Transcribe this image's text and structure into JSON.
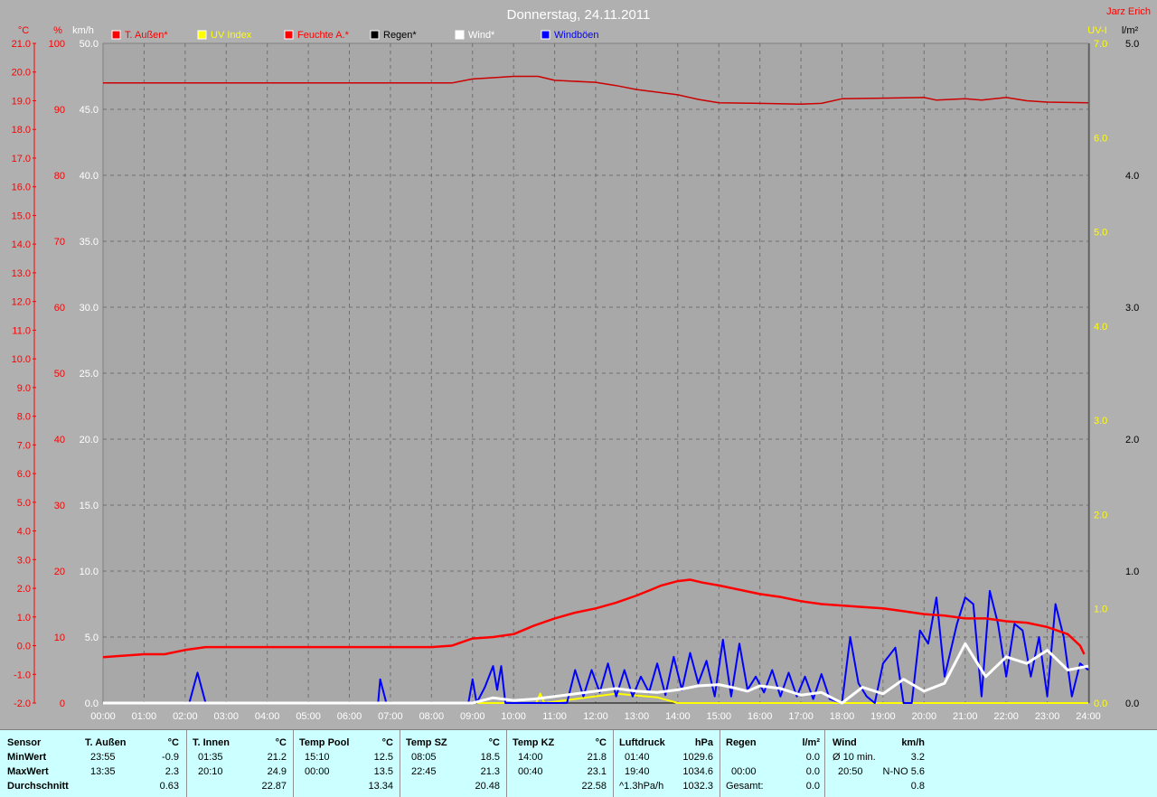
{
  "title": "Donnerstag, 24.11.2011",
  "author": "Jarz Erich",
  "colors": {
    "background": "#b0b0b0",
    "plot_bg": "#a8a8a8",
    "temp": "#ff0000",
    "humidity": "#cc0000",
    "uv": "#ffff00",
    "rain": "#000000",
    "wind": "#ffffff",
    "gust": "#0000ff",
    "panel_bg": "#ccffff"
  },
  "axes": {
    "temp_unit": "°C",
    "hum_unit": "%",
    "wind_unit": "km/h",
    "uv_unit": "UV-I",
    "rain_unit": "l/m²",
    "temp_ticks": [
      "21.0",
      "20.0",
      "19.0",
      "18.0",
      "17.0",
      "16.0",
      "15.0",
      "14.0",
      "13.0",
      "12.0",
      "11.0",
      "10.0",
      "9.0",
      "8.0",
      "7.0",
      "6.0",
      "5.0",
      "4.0",
      "3.0",
      "2.0",
      "1.0",
      "0.0",
      "-1.0",
      "-2.0"
    ],
    "hum_ticks": [
      "100",
      "90",
      "80",
      "70",
      "60",
      "50",
      "40",
      "30",
      "20",
      "10",
      "0"
    ],
    "wind_ticks": [
      "50.0",
      "45.0",
      "40.0",
      "35.0",
      "30.0",
      "25.0",
      "20.0",
      "15.0",
      "10.0",
      "5.0",
      "0.0"
    ],
    "uv_ticks": [
      "7.0",
      "6.0",
      "5.0",
      "4.0",
      "3.0",
      "2.0",
      "1.0",
      "0.0"
    ],
    "rain_ticks": [
      "5.0",
      "4.0",
      "3.0",
      "2.0",
      "1.0",
      "0.0"
    ],
    "time_ticks": [
      "00:00",
      "01:00",
      "02:00",
      "03:00",
      "04:00",
      "05:00",
      "06:00",
      "07:00",
      "08:00",
      "09:00",
      "10:00",
      "11:00",
      "12:00",
      "13:00",
      "14:00",
      "15:00",
      "16:00",
      "17:00",
      "18:00",
      "19:00",
      "20:00",
      "21:00",
      "22:00",
      "23:00",
      "24:00"
    ]
  },
  "legend": [
    {
      "label": "T. Außen*",
      "color": "#ff0000"
    },
    {
      "label": "UV Index",
      "color": "#ffff00"
    },
    {
      "label": "Feuchte A.*",
      "color": "#ff0000"
    },
    {
      "label": "Regen*",
      "color": "#000000"
    },
    {
      "label": "Wind*",
      "color": "#ffffff"
    },
    {
      "label": "Windböen",
      "color": "#0000ff"
    }
  ],
  "chart_data": {
    "type": "line",
    "title": "Donnerstag, 24.11.2011",
    "x_unit": "hours",
    "xlim": [
      0,
      24
    ],
    "grid": true,
    "legend_position": "top",
    "series": [
      {
        "name": "T. Außen*",
        "axis": "temp",
        "ylim": [
          -2,
          21
        ],
        "points": [
          [
            0,
            -0.4
          ],
          [
            0.5,
            -0.35
          ],
          [
            1,
            -0.3
          ],
          [
            1.5,
            -0.3
          ],
          [
            2,
            -0.15
          ],
          [
            2.5,
            -0.05
          ],
          [
            3,
            -0.05
          ],
          [
            3.5,
            -0.05
          ],
          [
            4,
            -0.05
          ],
          [
            5,
            -0.05
          ],
          [
            6,
            -0.05
          ],
          [
            7,
            -0.05
          ],
          [
            8,
            -0.05
          ],
          [
            8.5,
            0.0
          ],
          [
            9,
            0.25
          ],
          [
            9.5,
            0.3
          ],
          [
            10,
            0.4
          ],
          [
            10.5,
            0.7
          ],
          [
            11,
            0.95
          ],
          [
            11.5,
            1.15
          ],
          [
            12,
            1.3
          ],
          [
            12.5,
            1.5
          ],
          [
            13,
            1.75
          ],
          [
            13.35,
            1.95
          ],
          [
            13.6,
            2.1
          ],
          [
            14,
            2.25
          ],
          [
            14.3,
            2.3
          ],
          [
            14.6,
            2.2
          ],
          [
            15,
            2.1
          ],
          [
            15.5,
            1.95
          ],
          [
            16,
            1.8
          ],
          [
            16.5,
            1.7
          ],
          [
            17,
            1.55
          ],
          [
            17.5,
            1.45
          ],
          [
            18,
            1.4
          ],
          [
            18.5,
            1.35
          ],
          [
            19,
            1.3
          ],
          [
            19.5,
            1.2
          ],
          [
            20,
            1.1
          ],
          [
            20.5,
            1.05
          ],
          [
            21,
            0.95
          ],
          [
            21.5,
            0.95
          ],
          [
            22,
            0.85
          ],
          [
            22.5,
            0.8
          ],
          [
            23,
            0.65
          ],
          [
            23.5,
            0.4
          ],
          [
            23.8,
            0.0
          ],
          [
            23.9,
            -0.3
          ]
        ]
      },
      {
        "name": "Feuchte A.*",
        "axis": "hum",
        "ylim": [
          0,
          100
        ],
        "points": [
          [
            0,
            94
          ],
          [
            8.5,
            94
          ],
          [
            9,
            94.6
          ],
          [
            9.5,
            94.8
          ],
          [
            10,
            95
          ],
          [
            10.6,
            95
          ],
          [
            11,
            94.4
          ],
          [
            12,
            94.1
          ],
          [
            12.5,
            93.6
          ],
          [
            13,
            93
          ],
          [
            14,
            92.2
          ],
          [
            14.5,
            91.5
          ],
          [
            15,
            91
          ],
          [
            16,
            90.9
          ],
          [
            17,
            90.8
          ],
          [
            17.5,
            90.9
          ],
          [
            18,
            91.6
          ],
          [
            19,
            91.7
          ],
          [
            20,
            91.8
          ],
          [
            20.3,
            91.4
          ],
          [
            21,
            91.6
          ],
          [
            21.4,
            91.4
          ],
          [
            22,
            91.8
          ],
          [
            22.5,
            91.3
          ],
          [
            23,
            91.1
          ],
          [
            24,
            91.0
          ]
        ]
      },
      {
        "name": "Wind*",
        "axis": "wind",
        "ylim": [
          0,
          50
        ],
        "points": [
          [
            0,
            0
          ],
          [
            9,
            0
          ],
          [
            9.5,
            0.4
          ],
          [
            10,
            0.2
          ],
          [
            10.5,
            0.3
          ],
          [
            11,
            0.5
          ],
          [
            12,
            0.9
          ],
          [
            12.5,
            1.1
          ],
          [
            13,
            0.9
          ],
          [
            13.5,
            0.8
          ],
          [
            14,
            1.0
          ],
          [
            14.5,
            1.3
          ],
          [
            15,
            1.4
          ],
          [
            15.3,
            1.2
          ],
          [
            15.7,
            0.9
          ],
          [
            16,
            1.3
          ],
          [
            16.5,
            1.1
          ],
          [
            17,
            0.6
          ],
          [
            17.5,
            0.8
          ],
          [
            18,
            0
          ],
          [
            18.5,
            1.2
          ],
          [
            19,
            0.7
          ],
          [
            19.5,
            1.8
          ],
          [
            20,
            0.9
          ],
          [
            20.5,
            1.5
          ],
          [
            21,
            4.5
          ],
          [
            21.5,
            2.0
          ],
          [
            22,
            3.5
          ],
          [
            22.5,
            3.0
          ],
          [
            23,
            4.0
          ],
          [
            23.5,
            2.5
          ],
          [
            24,
            2.8
          ]
        ]
      },
      {
        "name": "Windböen",
        "axis": "wind",
        "ylim": [
          0,
          50
        ],
        "points": [
          [
            0,
            0
          ],
          [
            2.1,
            0
          ],
          [
            2.3,
            2.3
          ],
          [
            2.5,
            0
          ],
          [
            6.7,
            0
          ],
          [
            6.75,
            1.8
          ],
          [
            6.9,
            0
          ],
          [
            8.9,
            0
          ],
          [
            9.0,
            1.8
          ],
          [
            9.1,
            0
          ],
          [
            9.3,
            1.2
          ],
          [
            9.5,
            2.8
          ],
          [
            9.6,
            1.0
          ],
          [
            9.7,
            2.8
          ],
          [
            9.8,
            0
          ],
          [
            11.3,
            0
          ],
          [
            11.5,
            2.5
          ],
          [
            11.7,
            0.5
          ],
          [
            11.9,
            2.5
          ],
          [
            12.1,
            0.8
          ],
          [
            12.3,
            3.0
          ],
          [
            12.5,
            0.5
          ],
          [
            12.7,
            2.5
          ],
          [
            12.9,
            0.5
          ],
          [
            13.1,
            2.0
          ],
          [
            13.3,
            0.8
          ],
          [
            13.5,
            3.0
          ],
          [
            13.7,
            0.6
          ],
          [
            13.9,
            3.5
          ],
          [
            14.1,
            1.0
          ],
          [
            14.3,
            3.8
          ],
          [
            14.5,
            1.5
          ],
          [
            14.7,
            3.2
          ],
          [
            14.9,
            0.5
          ],
          [
            15.1,
            4.8
          ],
          [
            15.3,
            0.5
          ],
          [
            15.5,
            4.5
          ],
          [
            15.7,
            1.0
          ],
          [
            15.9,
            2.0
          ],
          [
            16.1,
            0.8
          ],
          [
            16.3,
            2.5
          ],
          [
            16.5,
            0.5
          ],
          [
            16.7,
            2.3
          ],
          [
            16.9,
            0.5
          ],
          [
            17.1,
            2.0
          ],
          [
            17.3,
            0.3
          ],
          [
            17.5,
            2.2
          ],
          [
            17.7,
            0.3
          ],
          [
            18,
            0
          ],
          [
            18.2,
            5.0
          ],
          [
            18.4,
            1.5
          ],
          [
            18.6,
            0.5
          ],
          [
            18.8,
            0
          ],
          [
            19.0,
            3.0
          ],
          [
            19.3,
            4.2
          ],
          [
            19.5,
            0
          ],
          [
            19.7,
            0
          ],
          [
            19.9,
            5.5
          ],
          [
            20.1,
            4.5
          ],
          [
            20.3,
            8.0
          ],
          [
            20.5,
            2.0
          ],
          [
            20.8,
            6.0
          ],
          [
            21.0,
            8.0
          ],
          [
            21.2,
            7.5
          ],
          [
            21.4,
            0.5
          ],
          [
            21.6,
            8.5
          ],
          [
            21.8,
            6.0
          ],
          [
            22.0,
            2.0
          ],
          [
            22.2,
            6.0
          ],
          [
            22.4,
            5.5
          ],
          [
            22.6,
            2.0
          ],
          [
            22.8,
            5.0
          ],
          [
            23.0,
            0.5
          ],
          [
            23.2,
            7.5
          ],
          [
            23.4,
            5.0
          ],
          [
            23.6,
            0.5
          ],
          [
            23.8,
            3.0
          ],
          [
            24,
            2.5
          ]
        ]
      },
      {
        "name": "UV Index",
        "axis": "uv",
        "ylim": [
          0,
          7
        ],
        "points": [
          [
            0,
            0
          ],
          [
            10.55,
            0
          ],
          [
            10.65,
            0.1
          ],
          [
            10.75,
            0
          ],
          [
            12.5,
            0.1
          ],
          [
            13.5,
            0.06
          ],
          [
            14,
            0
          ],
          [
            24,
            0
          ]
        ]
      },
      {
        "name": "Regen*",
        "axis": "rain",
        "ylim": [
          0,
          5
        ],
        "points": [
          [
            0,
            0
          ],
          [
            24,
            0
          ]
        ]
      }
    ]
  },
  "stats": {
    "row_labels": [
      "Sensor",
      "MinWert",
      "MaxWert",
      "Durchschnitt"
    ],
    "columns": [
      {
        "name": "T. Außen",
        "unit": "°C",
        "min_time": "23:55",
        "min_val": "-0.9",
        "max_time": "13:35",
        "max_val": "2.3",
        "avg": "0.63"
      },
      {
        "name": "T. Innen",
        "unit": "°C",
        "min_time": "01:35",
        "min_val": "21.2",
        "max_time": "20:10",
        "max_val": "24.9",
        "avg": "22.87"
      },
      {
        "name": "Temp Pool",
        "unit": "°C",
        "min_time": "15:10",
        "min_val": "12.5",
        "max_time": "00:00",
        "max_val": "13.5",
        "avg": "13.34"
      },
      {
        "name": "Temp SZ",
        "unit": "°C",
        "min_time": "08:05",
        "min_val": "18.5",
        "max_time": "22:45",
        "max_val": "21.3",
        "avg": "20.48"
      },
      {
        "name": "Temp KZ",
        "unit": "°C",
        "min_time": "14:00",
        "min_val": "21.8",
        "max_time": "00:40",
        "max_val": "23.1",
        "avg": "22.58"
      },
      {
        "name": "Luftdruck",
        "unit": "hPa",
        "min_time": "01:40",
        "min_val": "1029.6",
        "max_time": "19:40",
        "max_val": "1034.6",
        "avg_label": "^1.3hPa/h",
        "avg": "1032.3"
      }
    ],
    "rain": {
      "name": "Regen",
      "unit": "l/m²",
      "max_time": "00:00",
      "max_val": "0.0",
      "min_val": "0.0",
      "total_label": "Gesamt:",
      "total": "0.0"
    },
    "wind": {
      "name": "Wind",
      "unit": "km/h",
      "row1_label": "Ø 10 min.",
      "row1_val": "3.2",
      "row2_time": "20:50",
      "row2_val": "N-NO 5.6",
      "avg": "0.8"
    }
  }
}
